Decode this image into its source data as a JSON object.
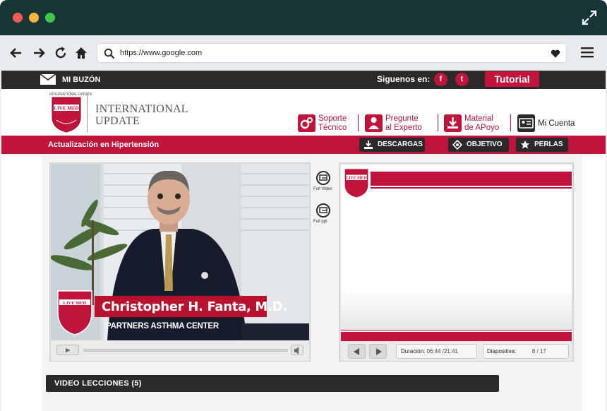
{
  "browser": {
    "url": "https://www.google.com"
  },
  "site": {
    "topbar": {
      "mailbox_label": "MI BUZÓN",
      "follow_label": "Siguenos en:",
      "facebook_glyph": "f",
      "twitter_glyph": "t",
      "tutorial_label": "Tutorial"
    },
    "logo": {
      "tiny_text": "INTERNATIONAL UPDATE",
      "brand_line1": "INTERNATIONAL",
      "brand_line2": "UPDATE",
      "shield_word": "LIVE MED"
    },
    "header_links": [
      {
        "line1": "Soporte",
        "line2": "Técnico",
        "icon": "gears-icon"
      },
      {
        "line1": "Pregunte",
        "line2": "al Experto",
        "icon": "person-icon"
      },
      {
        "line1": "Material",
        "line2": "de APoyo",
        "icon": "download-icon"
      }
    ],
    "account_label": "Mi Cuenta",
    "course_title": "Actualización en Hipertensión",
    "tools": {
      "downloads": "DESCARGAS",
      "objective": "OBJETIVO",
      "pearls": "PERLAS"
    },
    "video": {
      "speaker_name": "Christopher H. Fanta, M.D.",
      "speaker_org": "PARTNERS ASTHMA CENTER",
      "full_video_label": "Full Video",
      "full_ppt_label": "Full ppt"
    },
    "slides": {
      "duration_label": "Duración:",
      "duration_value": "06:44 /21:41",
      "slide_label": "Diapositiva:",
      "slide_current": "8",
      "slide_separator": "/",
      "slide_total": "17"
    },
    "lessons_label": "VIDEO LECCIONES (5)"
  },
  "colors": {
    "accent": "#c0143c",
    "dark": "#2a2a2a",
    "chrome_title": "#163537"
  }
}
